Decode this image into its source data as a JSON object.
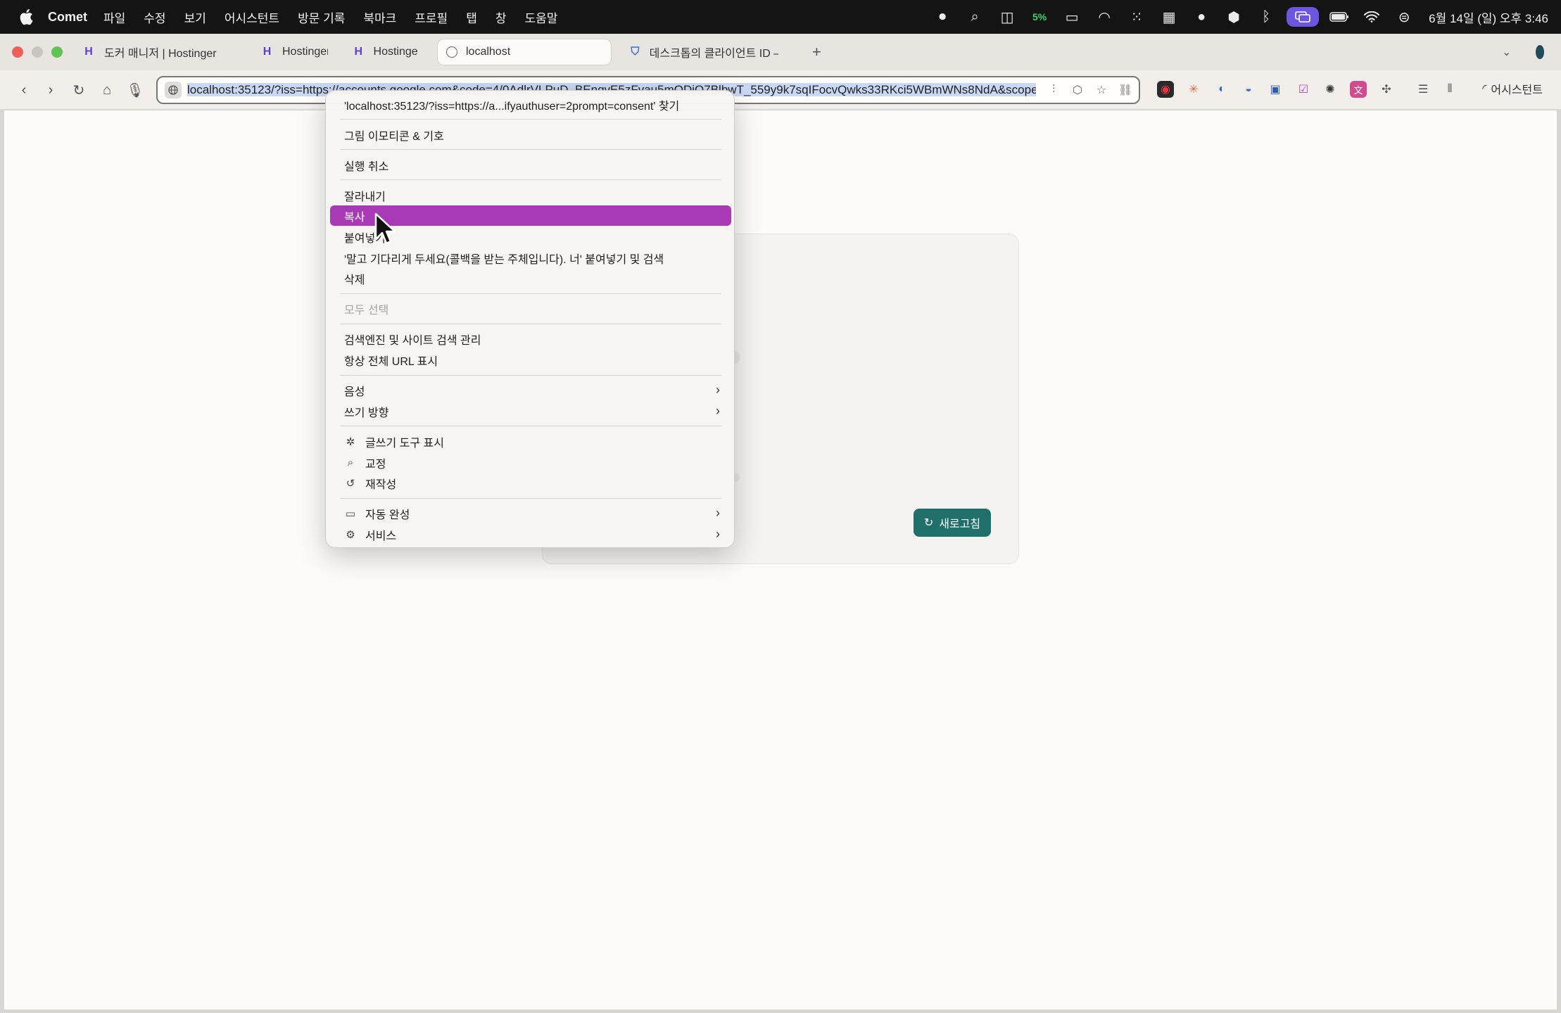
{
  "menubar": {
    "app_name": "Comet",
    "items": [
      "파일",
      "수정",
      "보기",
      "어시스턴트",
      "방문 기록",
      "북마크",
      "프로필",
      "탭",
      "창",
      "도움말"
    ],
    "battery_percent": "5%",
    "datetime": "6월 14일 (일) 오후 3:46"
  },
  "tabs": [
    {
      "title": "도커 매니저 | Hostinger",
      "active": false
    },
    {
      "title": "Hostinger",
      "active": false
    },
    {
      "title": "Hostinger",
      "active": false
    },
    {
      "title": "localhost",
      "active": true
    },
    {
      "title": "데스크톱의 클라이언트 ID – Goo",
      "active": false
    }
  ],
  "new_tab_label": "+",
  "address_bar": {
    "url": "localhost:35123/?iss=https://accounts.google.com&code=4/0AdlrVLPuD_BEnqvE5zFvau5mODiQ7BlbwT_559y9k7sqIFocvQwks33RKci5WBmWNs8NdA&scope"
  },
  "toolbar": {
    "assistant_label": "어시스턴트"
  },
  "page": {
    "refresh_label": "새로고침"
  },
  "context_menu": {
    "find": "'localhost:35123/?iss=https://a...ifyauthuser=2prompt=consent' 찾기",
    "emoji": "그림 이모티콘 & 기호",
    "undo": "실행 취소",
    "cut": "잘라내기",
    "copy": "복사",
    "paste": "붙여넣기",
    "paste_search": "'말고 기다리게 두세요(콜백을 받는 주체입니다). 너' 붙여넣기 및 검색",
    "delete": "삭제",
    "select_all": "모두 선택",
    "manage_search": "검색엔진 및 사이트 검색 관리",
    "show_full_url": "항상 전체 URL 표시",
    "speech": "음성",
    "writing_direction": "쓰기 방향",
    "writing_tools": "글쓰기 도구 표시",
    "proofread": "교정",
    "rewrite": "재작성",
    "autofill": "자동 완성",
    "services": "서비스"
  }
}
